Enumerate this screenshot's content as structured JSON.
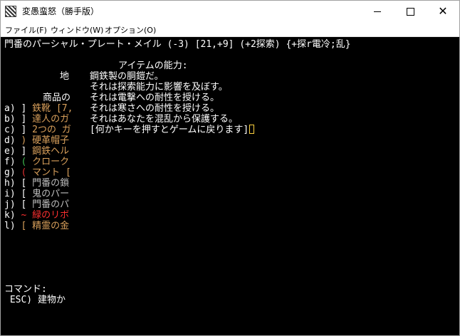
{
  "window": {
    "title": "変愚蛮怒（勝手版）",
    "controls": {
      "minimize": "minimize",
      "maximize": "maximize",
      "close": "✕"
    }
  },
  "menu": [
    {
      "label": "ファイル(F)"
    },
    {
      "label": "ウィンドウ(W)"
    },
    {
      "label": "オプション(O)"
    }
  ],
  "status_line": "門番のパーシャル・プレート・メイル (-3) [21,+9] (+2探索) {+探r電冷;乱}",
  "info": {
    "title": "アイテムの能力:",
    "lines": [
      "鋼鉄製の胴鎧だ。",
      "それは探索能力に影響を及ぼす。",
      "それは電撃への耐性を授ける。",
      "それは寒さへの耐性を授ける。",
      "それはあなたを混乱から保護する。",
      "[何かキーを押すとゲームに戻ります]"
    ]
  },
  "left_labels": {
    "ground": "地",
    "goods": "商品の"
  },
  "inventory": [
    {
      "key": "a) ]",
      "name": "鉄靴 [7,",
      "color": "#d9a05b"
    },
    {
      "key": "b) ]",
      "name": "達人のガ",
      "color": "#d9a05b"
    },
    {
      "key": "c) ]",
      "name": "2つの ガ",
      "color": "#d9a05b"
    },
    {
      "key": "d) )",
      "name": "硬革帽子",
      "color": "#d9a05b",
      "key_color": "#d9a05b"
    },
    {
      "key": "e) ]",
      "name": "鋼鉄ヘル",
      "color": "#d9a05b"
    },
    {
      "key": "f) (",
      "name": "クローク",
      "color": "#d9a05b",
      "key_color": "#3fb950"
    },
    {
      "key": "g) (",
      "name": "マント [",
      "color": "#d9a05b",
      "key_color": "#e03030"
    },
    {
      "key": "h) [",
      "name": "門番の鎖",
      "color": "#bdbdbd"
    },
    {
      "key": "i) [",
      "name": "鬼のパー",
      "color": "#bdbdbd"
    },
    {
      "key": "j) [",
      "name": "門番のパ",
      "color": "#bdbdbd"
    },
    {
      "key": "k) ~",
      "name": "緑のリボ",
      "color": "#ff3030",
      "key_color": "#ff3030"
    },
    {
      "key": "l) [",
      "name": "精霊の金",
      "color": "#d9a05b",
      "key_color": "#d9a05b"
    }
  ],
  "command": {
    "label": "コマンド:",
    "esc": " ESC) 建物か"
  }
}
